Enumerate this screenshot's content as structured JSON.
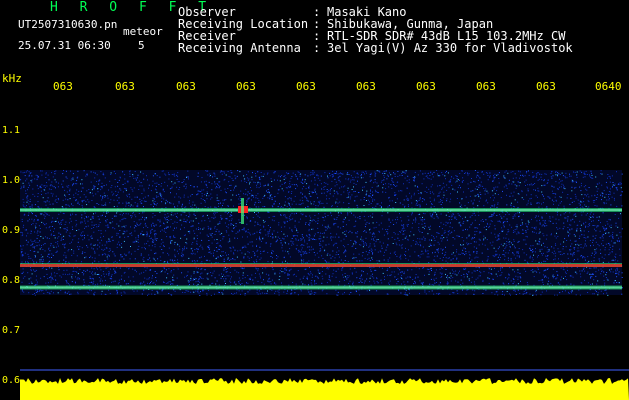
{
  "header": {
    "program": "H R O F F T",
    "filename": "UT2507310630.pn",
    "detection_label": "meteor",
    "datetime": "25.07.31 06:30",
    "count": "5",
    "info": [
      {
        "label": "Observer",
        "sep": ":",
        "value": "Masaki Kano"
      },
      {
        "label": "Receiving Location",
        "sep": ":",
        "value": "Shibukawa, Gunma, Japan"
      },
      {
        "label": "Receiver",
        "sep": ":",
        "value": "RTL-SDR SDR# 43dB L15 103.2MHz CW"
      },
      {
        "label": "Receiving Antenna",
        "sep": ":",
        "value": "3el Yagi(V) Az 330 for Vladivostok"
      }
    ]
  },
  "chart_data": {
    "type": "heatmap",
    "ylabel": "kHz",
    "yticks": [
      "1.1",
      "1.0",
      "0.9",
      "0.8",
      "0.7",
      "0.6"
    ],
    "ytick_values": [
      1.1,
      1.0,
      0.9,
      0.8,
      0.7,
      0.6
    ],
    "ylim": [
      0.6,
      1.1
    ],
    "xticks": [
      "063",
      "063",
      "063",
      "063",
      "063",
      "063",
      "063",
      "063",
      "063",
      "0640"
    ],
    "lines_khz": [
      0.94,
      0.83,
      0.785
    ],
    "colors": {
      "text_header": "#ffffff",
      "axis_text": "#ffff00",
      "title": "#00ff55",
      "noise": "#1030c0",
      "line": "#30ff80",
      "peak": "#ff2020",
      "power": "#ffff00"
    }
  }
}
